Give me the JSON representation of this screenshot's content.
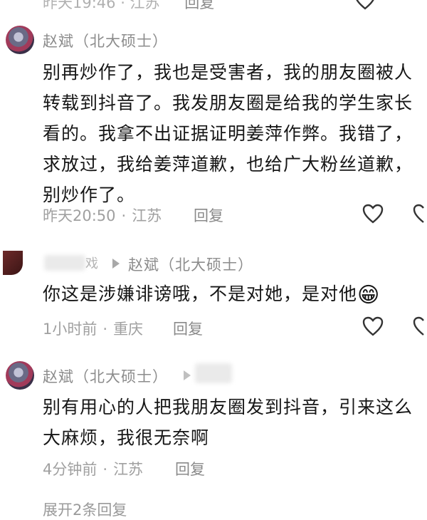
{
  "top_partial": {
    "meta": "昨天19:46 · 江苏",
    "reply": "回复"
  },
  "comments": [
    {
      "author": "赵斌（北大硕士）",
      "text_lines": [
        "别再炒作了，我也是受害者，我的朋友圈被人",
        "转载到抖音了。我发朋友圈是给我的学生家长",
        "看的。我拿不出证据证明姜萍作弊。我错了，",
        "求放过，我给姜萍道歉，也给广大粉丝道歉，",
        "别炒作了。"
      ],
      "time": "昨天20:50",
      "location": "江苏",
      "reply": "回复"
    },
    {
      "author_partial": "戏",
      "reply_to": "赵斌（北大硕士）",
      "text": "你这是涉嫌诽谤哦，不是对她，是对他",
      "emoji": "😁",
      "time": "1小时前",
      "location": "重庆",
      "reply": "回复"
    },
    {
      "author": "赵斌（北大硕士）",
      "text_lines": [
        "别有用心的人把我朋友圈发到抖音，引来这么",
        "大麻烦，我很无奈啊"
      ],
      "time": "4分钟前",
      "location": "江苏",
      "reply": "回复"
    }
  ],
  "bottom_partial": "展开2条回复",
  "icons": [
    "heart-outline-icon",
    "reply-arrow-icon"
  ],
  "colors": {
    "text": "#161616",
    "meta": "#a0a0a0",
    "name": "#8c8c8c",
    "background": "#ffffff"
  }
}
